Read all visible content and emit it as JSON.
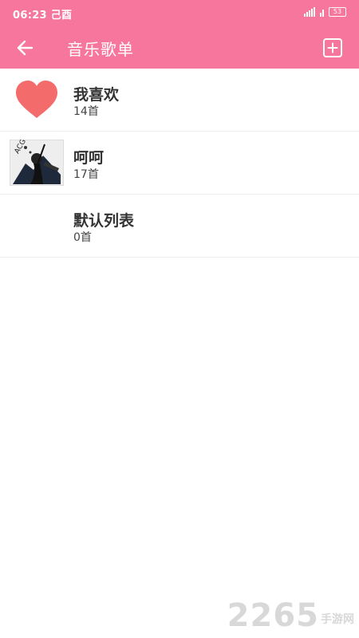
{
  "status_bar": {
    "time": "06:23 己酉",
    "battery": "53"
  },
  "header": {
    "title": "音乐歌单",
    "back_icon": "arrow-left-icon",
    "add_icon": "add-square-icon"
  },
  "playlists": [
    {
      "name": "我喜欢",
      "count": "14首",
      "thumbnail": "heart-icon"
    },
    {
      "name": "呵呵",
      "count": "17首",
      "thumbnail": "album-cover"
    },
    {
      "name": "默认列表",
      "count": "0首",
      "thumbnail": "none"
    }
  ],
  "watermark": {
    "main": "2265",
    "sub": "手游网"
  },
  "colors": {
    "accent": "#f7769e",
    "heart": "#f46b6b"
  }
}
